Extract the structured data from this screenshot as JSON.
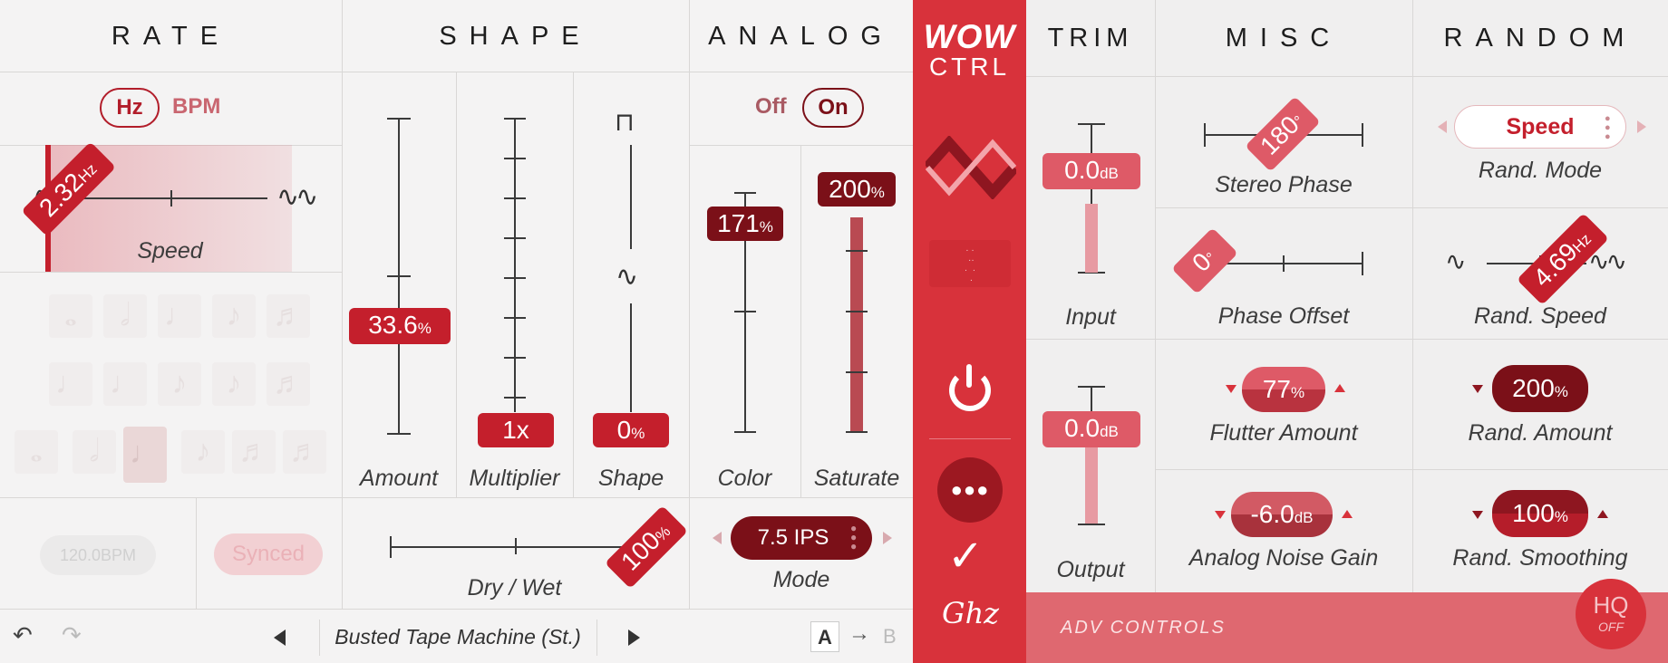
{
  "logo": {
    "wow": "WOW",
    "ctrl": "CTRL"
  },
  "sections": {
    "rate": "RATE",
    "shape": "SHAPE",
    "analog": "ANALOG",
    "trim": "TRIM",
    "misc": "MISC",
    "random": "RANDOM"
  },
  "rate": {
    "unit_hz": "Hz",
    "unit_bpm": "BPM",
    "speed_value": "2.32",
    "speed_unit": "Hz",
    "speed_label": "Speed",
    "bpm_value": "120.0BPM",
    "synced": "Synced"
  },
  "shape": {
    "amount_value": "33.6",
    "amount_unit": "%",
    "amount_label": "Amount",
    "multiplier_value": "1x",
    "multiplier_label": "Multiplier",
    "shape_value": "0",
    "shape_unit": "%",
    "shape_label": "Shape",
    "drywet_value": "100",
    "drywet_unit": "%",
    "drywet_label": "Dry / Wet"
  },
  "analog": {
    "off": "Off",
    "on": "On",
    "color_value": "171",
    "color_unit": "%",
    "color_label": "Color",
    "saturate_value": "200",
    "saturate_unit": "%",
    "saturate_label": "Saturate",
    "mode_value": "7.5 IPS",
    "mode_label": "Mode"
  },
  "trim": {
    "input_value": "0.0",
    "input_unit": "dB",
    "input_label": "Input",
    "output_value": "0.0",
    "output_unit": "dB",
    "output_label": "Output"
  },
  "misc": {
    "stereo_phase_value": "180",
    "stereo_phase_unit": "°",
    "stereo_phase_label": "Stereo Phase",
    "phase_offset_value": "0",
    "phase_offset_unit": "°",
    "phase_offset_label": "Phase Offset",
    "flutter_value": "77",
    "flutter_unit": "%",
    "flutter_label": "Flutter Amount",
    "noise_value": "-6.0",
    "noise_unit": "dB",
    "noise_label": "Analog Noise Gain"
  },
  "random": {
    "mode_value": "Speed",
    "mode_label": "Rand. Mode",
    "speed_value": "4.69",
    "speed_unit": "Hz",
    "speed_label": "Rand. Speed",
    "amount_value": "200",
    "amount_unit": "%",
    "amount_label": "Rand. Amount",
    "smoothing_value": "100",
    "smoothing_unit": "%",
    "smoothing_label": "Rand. Smoothing"
  },
  "footer": {
    "preset_name": "Busted Tape Machine (St.)",
    "a": "A",
    "b": "B",
    "adv_controls": "ADV CONTROLS",
    "hq": "HQ",
    "hq_state": "OFF"
  },
  "colors": {
    "accent": "#d8323b",
    "dark": "#7b1018",
    "pink": "#de5a67"
  }
}
